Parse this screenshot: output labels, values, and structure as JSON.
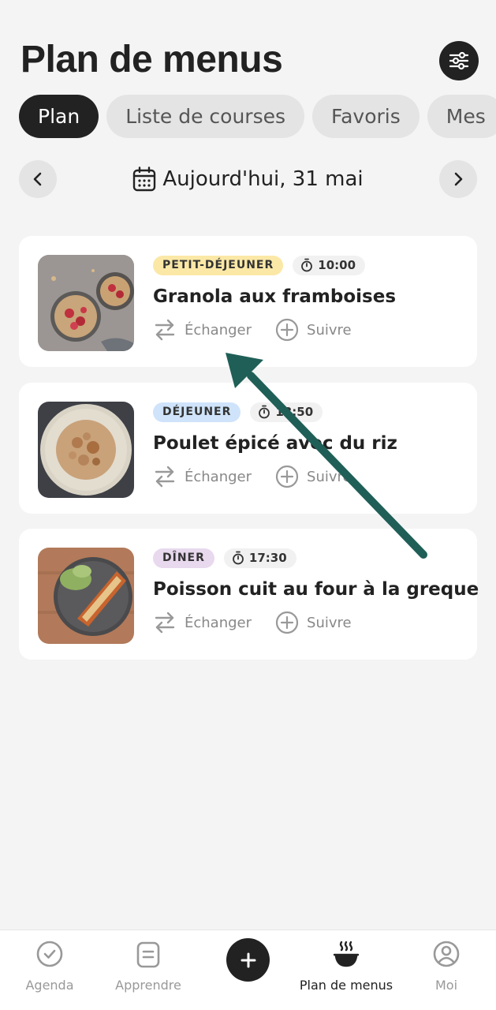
{
  "header": {
    "title": "Plan de menus",
    "filter_icon": "sliders-icon"
  },
  "tabs": [
    {
      "label": "Plan",
      "active": true
    },
    {
      "label": "Liste de courses",
      "active": false
    },
    {
      "label": "Favoris",
      "active": false
    },
    {
      "label": "Mes",
      "active": false
    }
  ],
  "date_nav": {
    "label": "Aujourd'hui, 31 mai",
    "prev_icon": "chevron-left-icon",
    "next_icon": "chevron-right-icon",
    "calendar_icon": "calendar-icon"
  },
  "meals": [
    {
      "meal": "PETIT-DÉJEUNER",
      "meal_color": "#fbe8a6",
      "time": "10:00",
      "title": "Granola aux framboises",
      "swap_label": "Échanger",
      "track_label": "Suivre"
    },
    {
      "meal": "DÉJEUNER",
      "meal_color": "#cfe3fa",
      "time": "13:50",
      "title": "Poulet épicé avec du riz",
      "swap_label": "Échanger",
      "track_label": "Suivre"
    },
    {
      "meal": "DÎNER",
      "meal_color": "#e8d9ee",
      "time": "17:30",
      "title": "Poisson cuit au four à la greque",
      "swap_label": "Échanger",
      "track_label": "Suivre"
    }
  ],
  "bottom_nav": {
    "agenda": "Agenda",
    "learn": "Apprendre",
    "menu_plan": "Plan de menus",
    "me": "Moi"
  },
  "colors": {
    "accent": "#222222",
    "annotation_arrow": "#1f5f57"
  }
}
